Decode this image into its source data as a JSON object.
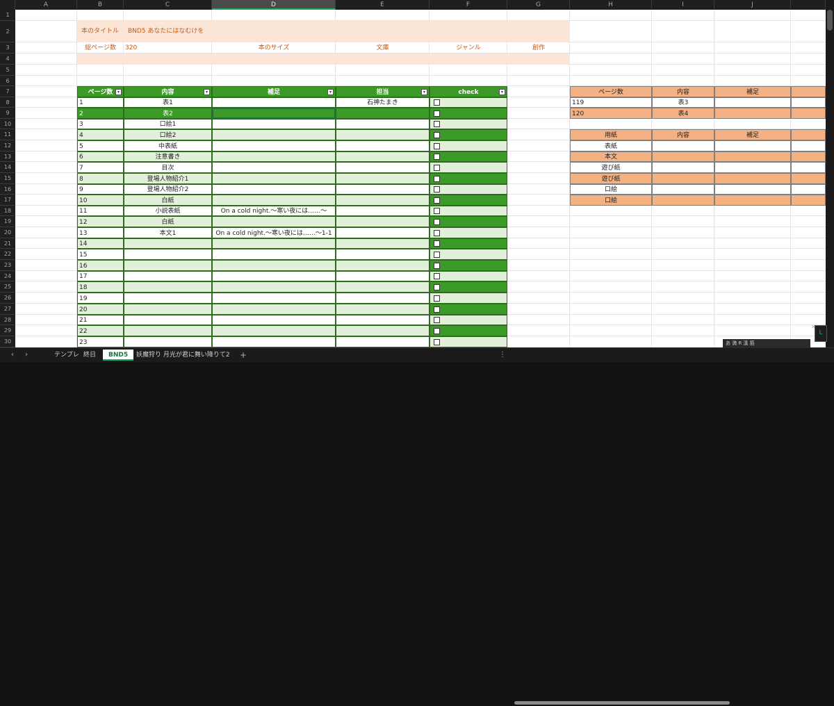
{
  "columns": [
    "A",
    "B",
    "C",
    "D",
    "E",
    "F",
    "G",
    "H",
    "I",
    "J"
  ],
  "selected_column": "D",
  "row_numbers": [
    "1",
    "2",
    "3",
    "4",
    "5",
    "6",
    "7",
    "8",
    "9",
    "10",
    "11",
    "12",
    "13",
    "14",
    "15",
    "16",
    "17",
    "18",
    "19",
    "20",
    "21",
    "22",
    "23",
    "24",
    "25",
    "26",
    "27",
    "28",
    "29",
    "30"
  ],
  "book_info": {
    "title_label": "本のタイトル",
    "title_value": "BND5 あなたにはなむけを",
    "pages_label": "総ページ数",
    "pages_value": "320",
    "size_label": "本のサイズ",
    "bunko_label": "文庫",
    "genre_label": "ジャンル",
    "sousaku_label": "創作"
  },
  "main_table": {
    "headers": [
      "ページ数",
      "内容",
      "補足",
      "担当",
      "check"
    ],
    "rows": [
      {
        "page": "1",
        "content": "表1",
        "note": "",
        "owner": "石神たまき"
      },
      {
        "page": "2",
        "content": "表2",
        "note": "",
        "owner": ""
      },
      {
        "page": "3",
        "content": "口絵1",
        "note": "",
        "owner": ""
      },
      {
        "page": "4",
        "content": "口絵2",
        "note": "",
        "owner": ""
      },
      {
        "page": "5",
        "content": "中表紙",
        "note": "",
        "owner": ""
      },
      {
        "page": "6",
        "content": "注意書き",
        "note": "",
        "owner": ""
      },
      {
        "page": "7",
        "content": "目次",
        "note": "",
        "owner": ""
      },
      {
        "page": "8",
        "content": "登場人物紹介1",
        "note": "",
        "owner": ""
      },
      {
        "page": "9",
        "content": "登場人物紹介2",
        "note": "",
        "owner": ""
      },
      {
        "page": "10",
        "content": "白紙",
        "note": "",
        "owner": ""
      },
      {
        "page": "11",
        "content": "小説表紙",
        "note": "On a cold night.〜寒い夜には……〜",
        "owner": ""
      },
      {
        "page": "12",
        "content": "白紙",
        "note": "",
        "owner": ""
      },
      {
        "page": "13",
        "content": "本文1",
        "note": "On a cold night.〜寒い夜には……〜1-1",
        "owner": ""
      },
      {
        "page": "14",
        "content": "",
        "note": "",
        "owner": ""
      },
      {
        "page": "15",
        "content": "",
        "note": "",
        "owner": ""
      },
      {
        "page": "16",
        "content": "",
        "note": "",
        "owner": ""
      },
      {
        "page": "17",
        "content": "",
        "note": "",
        "owner": ""
      },
      {
        "page": "18",
        "content": "",
        "note": "",
        "owner": ""
      },
      {
        "page": "19",
        "content": "",
        "note": "",
        "owner": ""
      },
      {
        "page": "20",
        "content": "",
        "note": "",
        "owner": ""
      },
      {
        "page": "21",
        "content": "",
        "note": "",
        "owner": ""
      },
      {
        "page": "22",
        "content": "",
        "note": "",
        "owner": ""
      },
      {
        "page": "23",
        "content": "",
        "note": "",
        "owner": ""
      }
    ]
  },
  "side_table1": {
    "headers": [
      "ページ数",
      "内容",
      "補足"
    ],
    "rows": [
      {
        "page": "119",
        "content": "表3",
        "note": ""
      },
      {
        "page": "120",
        "content": "表4",
        "note": ""
      }
    ]
  },
  "side_table2": {
    "headers": [
      "用紙",
      "内容",
      "補足"
    ],
    "rows": [
      {
        "paper": "表紙",
        "content": "",
        "note": ""
      },
      {
        "paper": "本文",
        "content": "",
        "note": ""
      },
      {
        "paper": "遊び紙",
        "content": "",
        "note": ""
      },
      {
        "paper": "遊び紙",
        "content": "",
        "note": ""
      },
      {
        "paper": "口絵",
        "content": "",
        "note": ""
      },
      {
        "paper": "口絵",
        "content": "",
        "note": ""
      }
    ]
  },
  "sheet_tabs": [
    "テンプレ",
    "終日",
    "BND5",
    "妖魔狩り 月光が君に舞い降りて2"
  ],
  "active_tab": "BND5",
  "tab_add": "+",
  "tab_nav": [
    "‹",
    "›"
  ],
  "tab_menu": "⋮",
  "ime_text": "あ 満 R 漢 筋",
  "colors": {
    "green_dark": "#3c9a29",
    "green_light": "#e2f0d9",
    "orange_header": "#f4b183",
    "peach_band": "#fbe5d6",
    "accent": "#21a366"
  },
  "icons": [
    "checkbox-icon",
    "filter-dropdown-icon",
    "add-sheet-icon",
    "excel-app-icon",
    "close-icon"
  ]
}
